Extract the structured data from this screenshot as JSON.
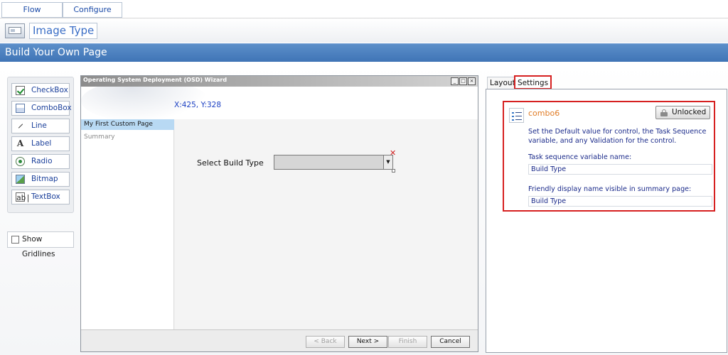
{
  "top_tabs": {
    "flow": "Flow",
    "configure": "Configure"
  },
  "header": {
    "image_type_title": "Image Type",
    "banner_title": "Build Your Own Page"
  },
  "toolbox": {
    "items": [
      {
        "label": "CheckBox",
        "icon": "checkbox-icon"
      },
      {
        "label": "ComboBox",
        "icon": "combobox-icon"
      },
      {
        "label": "Line",
        "icon": "line-icon"
      },
      {
        "label": "Label",
        "icon": "label-icon"
      },
      {
        "label": "Radio",
        "icon": "radio-icon"
      },
      {
        "label": "Bitmap",
        "icon": "bitmap-icon"
      },
      {
        "label": "TextBox",
        "icon": "textbox-icon"
      }
    ],
    "show_gridlines_label": "Show Gridlines"
  },
  "wizard": {
    "title": "Operating System Deployment (OSD) Wizard",
    "window_buttons": [
      "_",
      "□",
      "×"
    ],
    "coordinates": "X:425, Y:328",
    "nav": {
      "selected": "My First Custom Page",
      "item": "Summary"
    },
    "select_label": "Select Build Type",
    "buttons": {
      "back": "< Back",
      "next": "Next >",
      "finish": "Finish",
      "cancel": "Cancel"
    }
  },
  "properties": {
    "tabs": {
      "layout": "Layout",
      "settings": "Settings"
    },
    "control_name": "combo6",
    "unlocked_label": "Unlocked",
    "description": "Set the Default value for control, the Task Sequence variable, and any Validation for the control.",
    "ts_variable_label": "Task sequence variable name:",
    "ts_variable_value": "Build Type",
    "friendly_label": "Friendly display name visible in summary page:",
    "friendly_value": "Build Type"
  },
  "colors": {
    "banner": "#4a7fbf",
    "highlight_border": "#d62020",
    "control_name": "#e07b24"
  }
}
